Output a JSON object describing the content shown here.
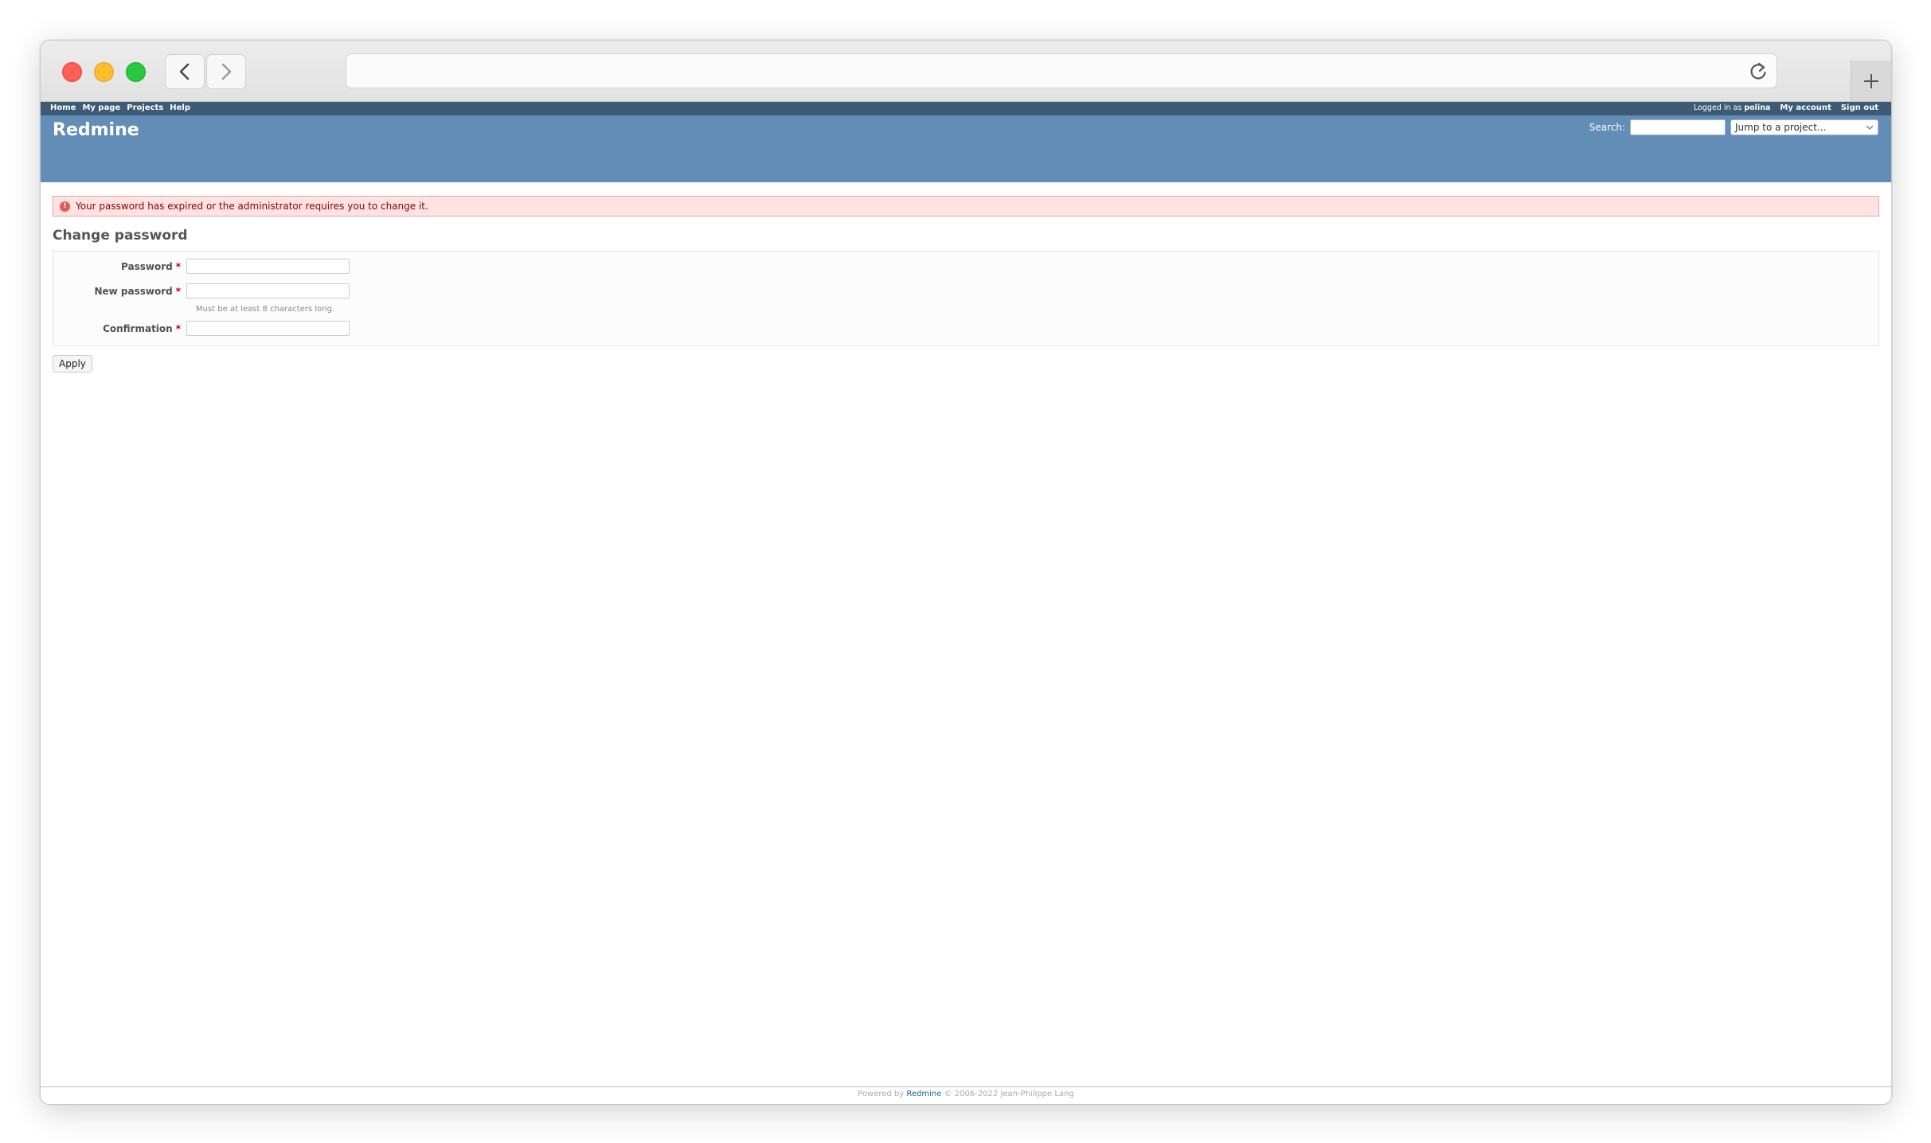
{
  "top_menu": {
    "items": [
      "Home",
      "My page",
      "Projects",
      "Help"
    ],
    "logged_in_prefix": "Logged in as",
    "username": "polina",
    "my_account": "My account",
    "sign_out": "Sign out"
  },
  "header": {
    "title": "Redmine",
    "search_label": "Search:",
    "jump_placeholder": "Jump to a project..."
  },
  "flash": {
    "error": "Your password has expired or the administrator requires you to change it."
  },
  "form": {
    "heading": "Change password",
    "password_label": "Password",
    "new_password_label": "New password",
    "hint": "Must be at least 8 characters long.",
    "confirmation_label": "Confirmation",
    "required_marker": "*",
    "apply_label": "Apply"
  },
  "footer": {
    "powered_by": "Powered by",
    "link": "Redmine",
    "copyright": "© 2006-2022 Jean-Philippe Lang"
  },
  "colors": {
    "top_menu_bg": "#3e5b76",
    "header_bg": "#628db6",
    "flash_bg": "#ffe3e3",
    "required": "#bb0000"
  }
}
